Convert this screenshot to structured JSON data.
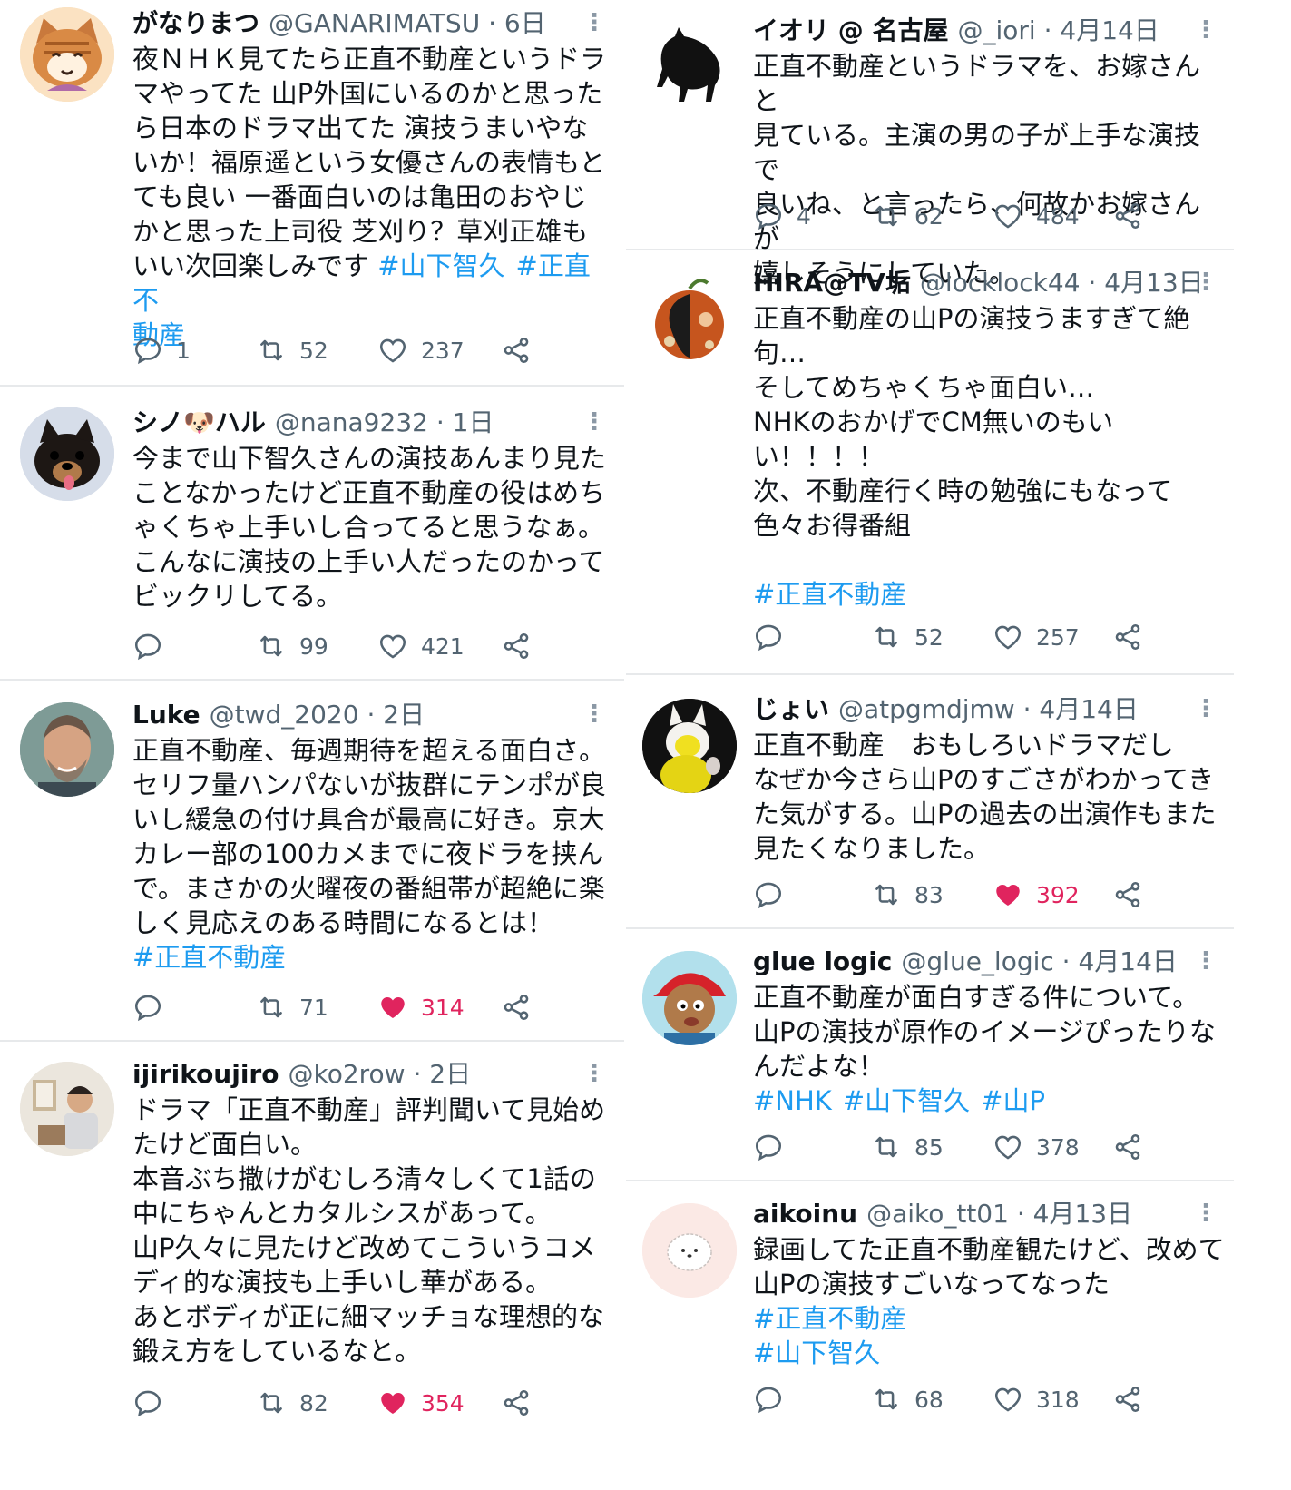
{
  "colors": {
    "link": "#1d9bf0",
    "meta": "#536471",
    "like_active": "#e0245e",
    "divider": "#e7e9eb"
  },
  "icons": {
    "reply": "reply-icon",
    "retweet": "retweet-icon",
    "like": "heart-icon",
    "share": "share-icon",
    "more": "more-vertical-icon"
  },
  "left": [
    {
      "name": "がなりまつ",
      "handle": "@GANARIMATSU",
      "time": "6日",
      "text": "夜ＮＨＫ見てたら正直不動産というドラ\nマやってた 山P外国にいるのかと思った\nら日本のドラマ出てた 演技うまいやな\nいか！福原遥という女優さんの表情もと\nても良い 一番面白いのは亀田のおやじ\nかと思った上司役 芝刈り？草刈正雄も\nいい次回楽しみです ",
      "tags_inline": [
        "#山下智久",
        "#正直不"
      ],
      "tags_line2": "動産",
      "replies": "1",
      "retweets": "52",
      "likes": "237",
      "liked": false
    },
    {
      "name": "シノ🐶ハル",
      "handle": "@nana9232",
      "time": "1日",
      "text": "今まで山下智久さんの演技あんまり見た\nことなかったけど正直不動産の役はめち\nゃくちゃ上手いし合ってると思うなぁ。\nこんなに演技の上手い人だったのかって\nビックリしてる。",
      "replies": "",
      "retweets": "99",
      "likes": "421",
      "liked": false
    },
    {
      "name": "Luke",
      "handle": "@twd_2020",
      "time": "2日",
      "text": "正直不動産、毎週期待を超える面白さ。\nセリフ量ハンパないが抜群にテンポが良\nいし緩急の付け具合が最高に好き。京大\nカレー部の100カメまでに夜ドラを挟ん\nで。まさかの火曜夜の番組帯が超絶に楽\nしく見応えのある時間になるとは！",
      "tags": [
        "#正直不動産"
      ],
      "replies": "",
      "retweets": "71",
      "likes": "314",
      "liked": true
    },
    {
      "name": "ijirikoujiro",
      "handle": "@ko2row",
      "time": "2日",
      "text": "ドラマ「正直不動産」評判聞いて見始め\nたけど面白い。\n本音ぶち撒けがむしろ清々しくて1話の\n中にちゃんとカタルシスがあって。\n山P久々に見たけど改めてこういうコメ\nディ的な演技も上手いし華がある。\nあとボディが正に細マッチョな理想的な\n鍛え方をしているなと。",
      "replies": "",
      "retweets": "82",
      "likes": "354",
      "liked": true
    }
  ],
  "right": [
    {
      "name": "イオリ @ 名古屋",
      "handle": "@_iori",
      "time": "4月14日",
      "text": "正直不動産というドラマを、お嫁さんと\n見ている。主演の男の子が上手な演技で\n良いね、と言ったら、何故かお嫁さんが\n嬉しそうにしていた。",
      "replies": "4",
      "retweets": "62",
      "likes": "484",
      "liked": false
    },
    {
      "name": "HIRA@TV垢",
      "handle": "@locklock44",
      "time": "4月13日",
      "text": "正直不動産の山Pの演技うますぎて絶\n句…\nそしてめちゃくちゃ面白い…\nNHKのおかげでCM無いのもい\nい！！！！\n次、不動産行く時の勉強にもなって\n色々お得番組\n",
      "tags": [
        "#正直不動産"
      ],
      "replies": "",
      "retweets": "52",
      "likes": "257",
      "liked": false
    },
    {
      "name": "じょい",
      "handle": "@atpgmdjmw",
      "time": "4月14日",
      "text": "正直不動産　おもしろいドラマだし\nなぜか今さら山Pのすごさがわかってき\nた気がする。山Pの過去の出演作もまた\n見たくなりました。",
      "replies": "",
      "retweets": "83",
      "likes": "392",
      "liked": true
    },
    {
      "name": "glue logic",
      "handle": "@glue_logic",
      "time": "4月14日",
      "text": "正直不動産が面白すぎる件について。\n山Pの演技が原作のイメージぴったりな\nんだよな！",
      "tags": [
        "#NHK",
        "#山下智久",
        "#山P"
      ],
      "replies": "",
      "retweets": "85",
      "likes": "378",
      "liked": false
    },
    {
      "name": "aikoinu",
      "handle": "@aiko_tt01",
      "time": "4月13日",
      "text": "録画してた正直不動産観たけど、改めて\n山Pの演技すごいなってなった",
      "tags_block": [
        "#正直不動産",
        "#山下智久"
      ],
      "replies": "",
      "retweets": "68",
      "likes": "318",
      "liked": false
    }
  ]
}
